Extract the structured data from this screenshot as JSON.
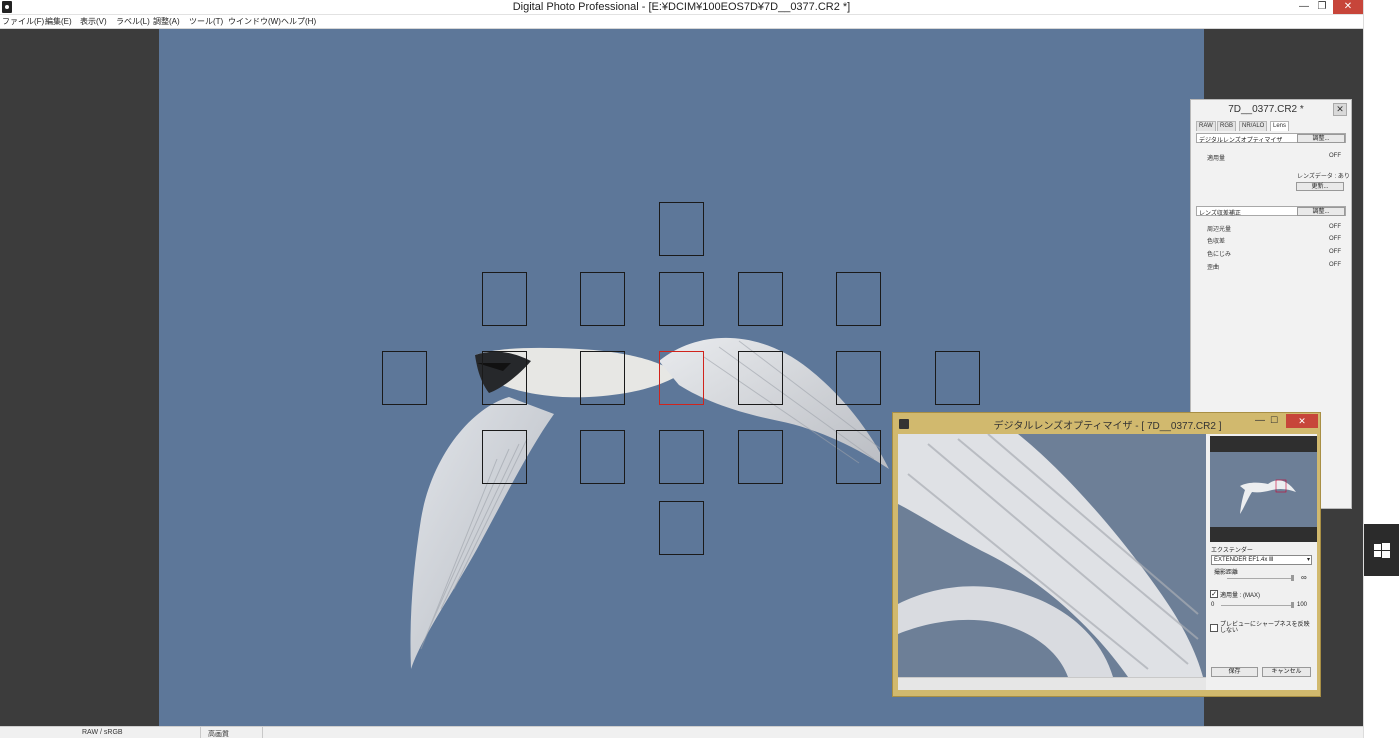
{
  "window": {
    "title": "Digital Photo Professional - [E:¥DCIM¥100EOS7D¥7D__0377.CR2 *]",
    "minimize": "—",
    "maximize": "❐",
    "close": "✕"
  },
  "menu": [
    "ファイル(F)",
    "編集(E)",
    "表示(V)",
    "ラベル(L)",
    "調整(A)",
    "ツール(T)",
    "ウインドウ(W)",
    "ヘルプ(H)"
  ],
  "af_points": {
    "selected": "center"
  },
  "status": {
    "color_space": "RAW / sRGB",
    "quality": "高画質"
  },
  "palette": {
    "title": "7D__0377.CR2 *",
    "close": "✕",
    "tabs": [
      "RAW",
      "RGB",
      "NR/ALO",
      "Lens"
    ],
    "dlo_section": "デジタルレンズオプティマイザ",
    "adjust_button": "調整...",
    "amount_label": "適用量",
    "amount_value": "OFF",
    "lens_data": "レンズデータ : あり",
    "update_button": "更新...",
    "aberration_section": "レンズ収差補正",
    "aberration_button": "調整...",
    "aberration_rows": [
      {
        "label": "周辺光量",
        "value": "OFF"
      },
      {
        "label": "色収差",
        "value": "OFF"
      },
      {
        "label": "色にじみ",
        "value": "OFF"
      },
      {
        "label": "歪曲",
        "value": "OFF"
      }
    ]
  },
  "dlo": {
    "title": "デジタルレンズオプティマイザ - [ 7D__0377.CR2 ]",
    "close": "✕",
    "minimize": "—",
    "maximize": "☐",
    "extender_label": "エクステンダー",
    "extender_value": "EXTENDER EF1.4x Ⅲ",
    "distance_label": "撮影距離",
    "infinity": "∞",
    "amount_label": "適用量 : (MAX)",
    "amount_checked": true,
    "amount_min": "0",
    "amount_max": "100",
    "amount_level": 1.0,
    "sharpness_label": "プレビューにシャープネスを反映しない",
    "sharpness_checked": false,
    "save_button": "保存",
    "cancel_button": "キャンセル"
  }
}
